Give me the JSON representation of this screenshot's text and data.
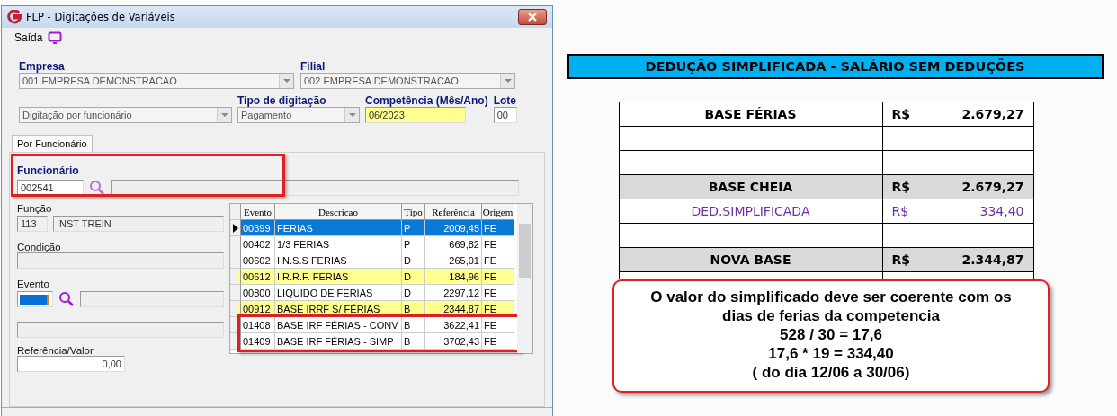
{
  "window": {
    "title": "FLP - Digitações de Variáveis",
    "menu": [
      "Saída"
    ]
  },
  "form": {
    "empresa": {
      "label": "Empresa",
      "value": "001 EMPRESA DEMONSTRACAO"
    },
    "filial": {
      "label": "Filial",
      "value": "002 EMPRESA DEMONSTRACAO"
    },
    "modo": {
      "value": "Digitação por funcionário"
    },
    "tipo": {
      "label": "Tipo de digitação",
      "value": "Pagamento"
    },
    "competencia": {
      "label": "Competência (Mês/Ano)",
      "value": "06/2023"
    },
    "lote": {
      "label": "Lote",
      "value": "00"
    }
  },
  "tabs": [
    {
      "label": "Por Funcionário",
      "selected": true
    }
  ],
  "funcionario": {
    "label": "Funcionário",
    "value": "002541",
    "annotated": true
  },
  "funcao": {
    "label": "Função",
    "code": "113",
    "name": "INST TREIN"
  },
  "condicao": {
    "label": "Condição"
  },
  "evento": {
    "label": "Evento"
  },
  "referencia": {
    "label": "Referência/Valor",
    "value": "0,00"
  },
  "grid": {
    "columns": [
      "Evento",
      "Descricao",
      "Tipo",
      "Referência",
      "Origem"
    ],
    "rows": [
      {
        "evento": "00399",
        "descricao": "FERIAS",
        "tipo": "P",
        "referencia": "2009,45",
        "origem": "FE",
        "selected": true,
        "highlighted": false,
        "annotated": false
      },
      {
        "evento": "00402",
        "descricao": "1/3 FERIAS",
        "tipo": "P",
        "referencia": "669,82",
        "origem": "FE",
        "selected": false,
        "highlighted": false,
        "annotated": false
      },
      {
        "evento": "00602",
        "descricao": "I.N.S.S FERIAS",
        "tipo": "D",
        "referencia": "265,01",
        "origem": "FE",
        "selected": false,
        "highlighted": false,
        "annotated": false
      },
      {
        "evento": "00612",
        "descricao": "I.R.R.F. FERIAS",
        "tipo": "D",
        "referencia": "184,96",
        "origem": "FE",
        "selected": false,
        "highlighted": true,
        "annotated": false
      },
      {
        "evento": "00800",
        "descricao": "LIQUIDO DE FERIAS",
        "tipo": "D",
        "referencia": "2297,12",
        "origem": "FE",
        "selected": false,
        "highlighted": false,
        "annotated": false
      },
      {
        "evento": "00912",
        "descricao": "BASE IRRF S/ FÉRIAS",
        "tipo": "B",
        "referencia": "2344,87",
        "origem": "FE",
        "selected": false,
        "highlighted": true,
        "annotated": false
      },
      {
        "evento": "01408",
        "descricao": "BASE IRF FÉRIAS - CONV",
        "tipo": "B",
        "referencia": "3622,41",
        "origem": "FE",
        "selected": false,
        "highlighted": false,
        "annotated": true
      },
      {
        "evento": "01409",
        "descricao": "BASE IRF FÉRIAS - SIMP",
        "tipo": "B",
        "referencia": "3702,43",
        "origem": "FE",
        "selected": false,
        "highlighted": false,
        "annotated": true
      }
    ]
  },
  "sheet": {
    "title": "DEDUÇÃO SIMPLIFICADA - SALÁRIO SEM DEDUÇÕES",
    "rows": [
      {
        "kind": "bold",
        "label": "BASE FÉRIAS",
        "currency": "R$",
        "amount": "2.679,27"
      },
      {
        "kind": "empty"
      },
      {
        "kind": "empty"
      },
      {
        "kind": "total",
        "label": "BASE CHEIA",
        "currency": "R$",
        "amount": "2.679,27"
      },
      {
        "kind": "purple",
        "label": "DED.SIMPLIFICADA",
        "currency": "R$",
        "amount": "334,40"
      },
      {
        "kind": "empty"
      },
      {
        "kind": "total",
        "label": "NOVA BASE",
        "currency": "R$",
        "amount": "2.344,87"
      }
    ]
  },
  "callout": {
    "lines": [
      "O valor do simplificado deve ser coerente com os",
      "dias de ferias da competencia",
      "528 / 30 = 17,6",
      "17,6 * 19 = 334,40",
      "( do dia 12/06 a 30/06)"
    ]
  }
}
